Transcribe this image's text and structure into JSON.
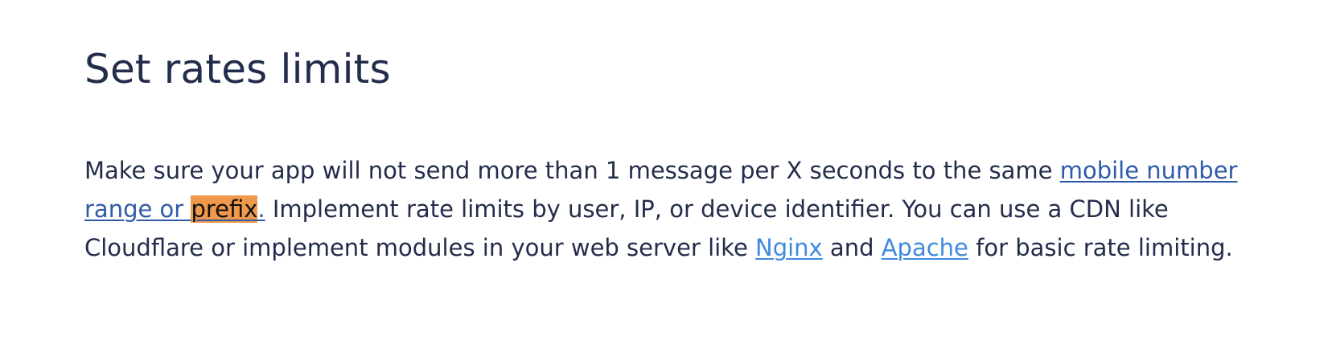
{
  "article": {
    "title": "Set rates limits",
    "paragraph": {
      "text_1": "Make sure your app will not send more than 1 message per X seconds to the same ",
      "link_1_part_a": "mobile number range or ",
      "link_1_highlight": "prefix",
      "link_1_part_b": ".",
      "text_2": " Implement rate limits by user, IP, or device identifier. You can use a CDN like Cloudflare or implement modules in your web server like ",
      "link_nginx": "Nginx",
      "text_3": " and ",
      "link_apache": "Apache",
      "text_4": " for basic rate limiting."
    }
  },
  "colors": {
    "text": "#232d4b",
    "link_visited": "#2f5aa8",
    "link": "#3f8ae0",
    "highlight": "#f0994a"
  }
}
